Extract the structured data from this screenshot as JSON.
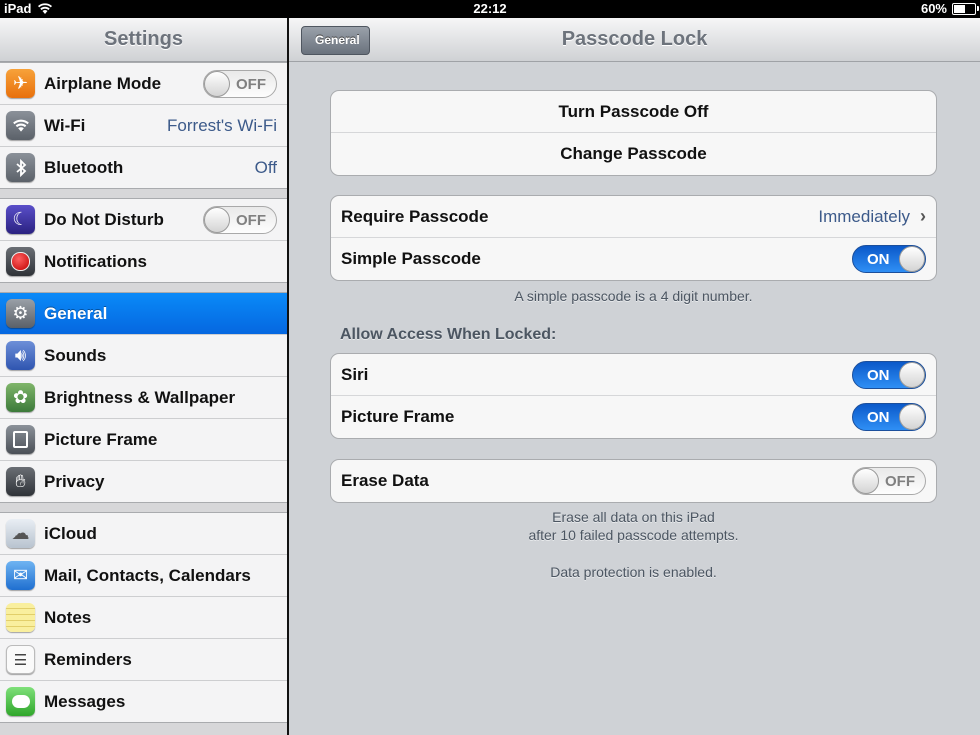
{
  "status_bar": {
    "carrier": "iPad",
    "time": "22:12",
    "battery": "60%",
    "battery_level": 0.6
  },
  "master": {
    "title": "Settings",
    "groups": [
      [
        {
          "label": "Airplane Mode",
          "icon": "airplane-icon",
          "toggle": "OFF"
        },
        {
          "label": "Wi-Fi",
          "icon": "wifi-icon",
          "value": "Forrest's Wi-Fi"
        },
        {
          "label": "Bluetooth",
          "icon": "bluetooth-icon",
          "value": "Off"
        }
      ],
      [
        {
          "label": "Do Not Disturb",
          "icon": "moon-icon",
          "toggle": "OFF"
        },
        {
          "label": "Notifications",
          "icon": "notifications-icon"
        }
      ],
      [
        {
          "label": "General",
          "icon": "gear-icon",
          "selected": true
        },
        {
          "label": "Sounds",
          "icon": "speaker-icon"
        },
        {
          "label": "Brightness & Wallpaper",
          "icon": "flower-icon"
        },
        {
          "label": "Picture Frame",
          "icon": "picture-frame-icon"
        },
        {
          "label": "Privacy",
          "icon": "hand-icon"
        }
      ],
      [
        {
          "label": "iCloud",
          "icon": "cloud-icon"
        },
        {
          "label": "Mail, Contacts, Calendars",
          "icon": "mail-icon"
        },
        {
          "label": "Notes",
          "icon": "notes-icon"
        },
        {
          "label": "Reminders",
          "icon": "reminders-icon"
        },
        {
          "label": "Messages",
          "icon": "messages-icon"
        }
      ]
    ]
  },
  "detail": {
    "back_label": "General",
    "title": "Passcode Lock",
    "turn_off_label": "Turn Passcode Off",
    "change_label": "Change Passcode",
    "require_label": "Require Passcode",
    "require_value": "Immediately",
    "simple_label": "Simple Passcode",
    "simple_toggle": "ON",
    "simple_note": "A simple passcode is a 4 digit number.",
    "allow_header": "Allow Access When Locked:",
    "siri_label": "Siri",
    "siri_toggle": "ON",
    "picture_frame_label": "Picture Frame",
    "picture_frame_toggle": "ON",
    "erase_label": "Erase Data",
    "erase_toggle": "OFF",
    "erase_note_1": "Erase all data on this iPad",
    "erase_note_2": "after 10 failed passcode attempts.",
    "protection_note": "Data protection is enabled."
  },
  "colors": {
    "selected_row": "#0a78f0",
    "value_text": "#3c5a8a",
    "toggle_on": "#1e78e8"
  }
}
